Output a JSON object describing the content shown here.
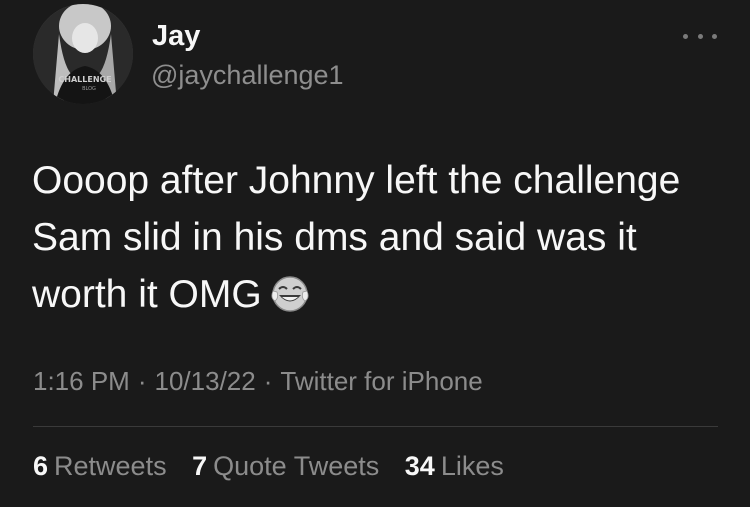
{
  "user": {
    "display_name": "Jay",
    "handle": "@jaychallenge1",
    "avatar_text": "CHALLENGE"
  },
  "tweet": {
    "text": "Oooop after Johnny left the challenge Sam slid in his dms and said was it worth it OMG",
    "emoji": "face-with-tears-of-joy-icon"
  },
  "meta": {
    "time": "1:16 PM",
    "separator": "·",
    "date": "10/13/22",
    "source": "Twitter for iPhone"
  },
  "stats": {
    "retweets_count": "6",
    "retweets_label": "Retweets",
    "quotes_count": "7",
    "quotes_label": "Quote Tweets",
    "likes_count": "34",
    "likes_label": "Likes"
  },
  "colors": {
    "background": "#1a1a1a",
    "primary_text": "#f7f7f7",
    "secondary_text": "#8c8c8c"
  }
}
